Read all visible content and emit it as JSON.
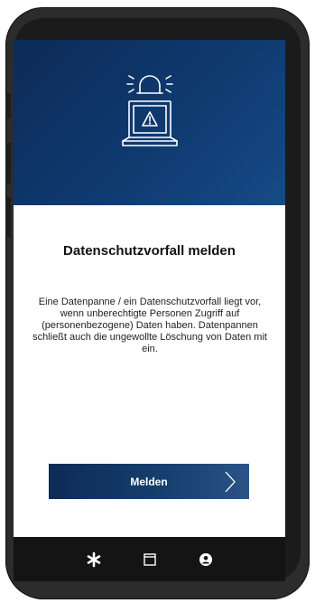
{
  "incident": {
    "title": "Datenschutzvorfall melden",
    "description": "Eine Datenpanne / ein Datenschutzvorfall liegt vor, wenn unberechtigte Personen Zugriff auf (personenbezogene) Daten haben. Datenpannen schließt auch die ungewollte Löschung von Daten mit ein.",
    "button_label": "Melden",
    "hero_icon": "alarm-laptop-warning-icon"
  },
  "navbar": {
    "items": [
      {
        "icon": "asterisk-icon"
      },
      {
        "icon": "square-icon"
      },
      {
        "icon": "user-circle-icon"
      }
    ]
  },
  "colors": {
    "hero_dark": "#0d2b56",
    "hero_light": "#174a86",
    "button": "#0d2b56"
  }
}
